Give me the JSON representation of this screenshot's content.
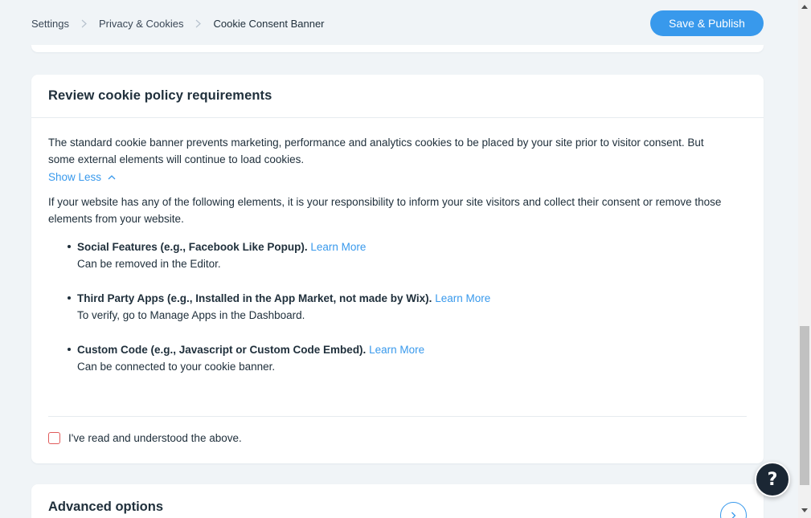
{
  "breadcrumb": {
    "items": [
      "Settings",
      "Privacy & Cookies"
    ],
    "current": "Cookie Consent Banner"
  },
  "header": {
    "publish_label": "Save & Publish"
  },
  "card": {
    "title": "Review cookie policy requirements",
    "intro": "The standard cookie banner prevents marketing, performance and analytics cookies to be placed by your site prior to visitor consent. But some external elements will continue to load cookies.",
    "show_less": "Show Less",
    "responsibility": "If your website has any of the following elements, it is your responsibility to inform your site visitors and collect their consent or remove those elements from your website.",
    "items": [
      {
        "title": "Social Features (e.g., Facebook Like Popup).",
        "link": "Learn More",
        "desc": "Can be removed in the Editor."
      },
      {
        "title": "Third Party Apps (e.g., Installed in the App Market, not made by Wix).",
        "link": "Learn More",
        "desc": "To verify, go to Manage Apps in the Dashboard."
      },
      {
        "title": "Custom Code (e.g., Javascript or Custom Code Embed).",
        "link": "Learn More",
        "desc": "Can be connected to your cookie banner."
      }
    ],
    "consent_label": "I've read and understood the above.",
    "consent_checked": false
  },
  "advanced": {
    "title": "Advanced options"
  },
  "help": {
    "label": "?"
  },
  "colors": {
    "accent": "#3899ec",
    "text": "#20303c",
    "error": "#e05a5a",
    "background": "#f0f4f7"
  }
}
